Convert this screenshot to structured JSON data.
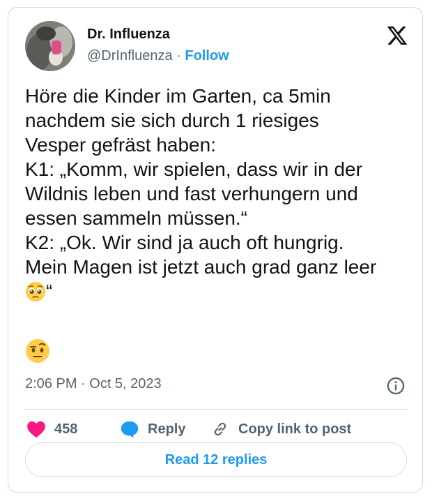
{
  "author": {
    "name": "Dr. Influenza",
    "handle": "@DrInfluenza",
    "separator": "·",
    "follow_label": "Follow"
  },
  "tweet": {
    "lines": [
      "Höre die Kinder im Garten, ca 5min",
      "nachdem sie sich durch 1 riesiges",
      "Vesper gefräst haben:",
      "K1: „Komm, wir spielen, dass wir in der",
      "Wildnis leben und fast verhungern und",
      "essen sammeln müssen.“",
      "K2: „Ok. Wir sind ja auch oft hungrig.",
      "Mein Magen ist jetzt auch grad ganz leer"
    ],
    "closing_quote": "“",
    "inline_emoji": "pleading-face",
    "standalone_emoji": "face-with-raised-eyebrow"
  },
  "meta": {
    "timestamp": "2:06 PM · Oct 5, 2023"
  },
  "actions": {
    "likes": "458",
    "reply_label": "Reply",
    "copy_link_label": "Copy link to post"
  },
  "read_replies_label": "Read 12 replies",
  "colors": {
    "accent": "#1d9bf0",
    "heart": "#f91880",
    "text": "#0f1419",
    "muted": "#536471",
    "border": "#cfd9de"
  }
}
